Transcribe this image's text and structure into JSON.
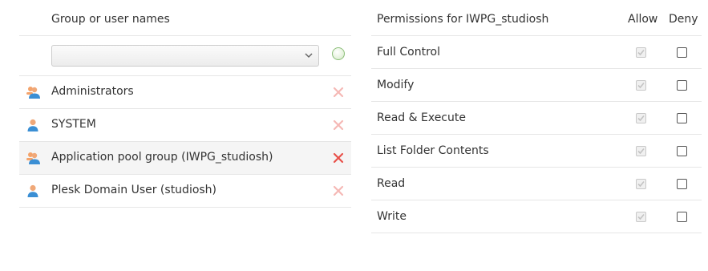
{
  "left": {
    "header": "Group or user names",
    "add_select_value": "",
    "add_button_icon": "add-circle-icon",
    "users": [
      {
        "name": "Administrators",
        "icon": "group-icon",
        "selected": false
      },
      {
        "name": "SYSTEM",
        "icon": "user-icon",
        "selected": false
      },
      {
        "name": "Application pool group (IWPG_studiosh)",
        "icon": "group-icon",
        "selected": true
      },
      {
        "name": "Plesk Domain User (studiosh)",
        "icon": "user-icon",
        "selected": false
      }
    ]
  },
  "right": {
    "header": "Permissions for IWPG_studiosh",
    "allow_label": "Allow",
    "deny_label": "Deny",
    "permissions": [
      {
        "name": "Full Control",
        "allow": true,
        "deny": false
      },
      {
        "name": "Modify",
        "allow": true,
        "deny": false
      },
      {
        "name": "Read & Execute",
        "allow": true,
        "deny": false
      },
      {
        "name": "List Folder Contents",
        "allow": true,
        "deny": false
      },
      {
        "name": "Read",
        "allow": true,
        "deny": false
      },
      {
        "name": "Write",
        "allow": true,
        "deny": false
      }
    ]
  },
  "colors": {
    "delete_active": "#e8514a",
    "delete_inactive": "#f5b8b5",
    "user_head": "#f3a36b",
    "user_body": "#3b8fd4"
  }
}
